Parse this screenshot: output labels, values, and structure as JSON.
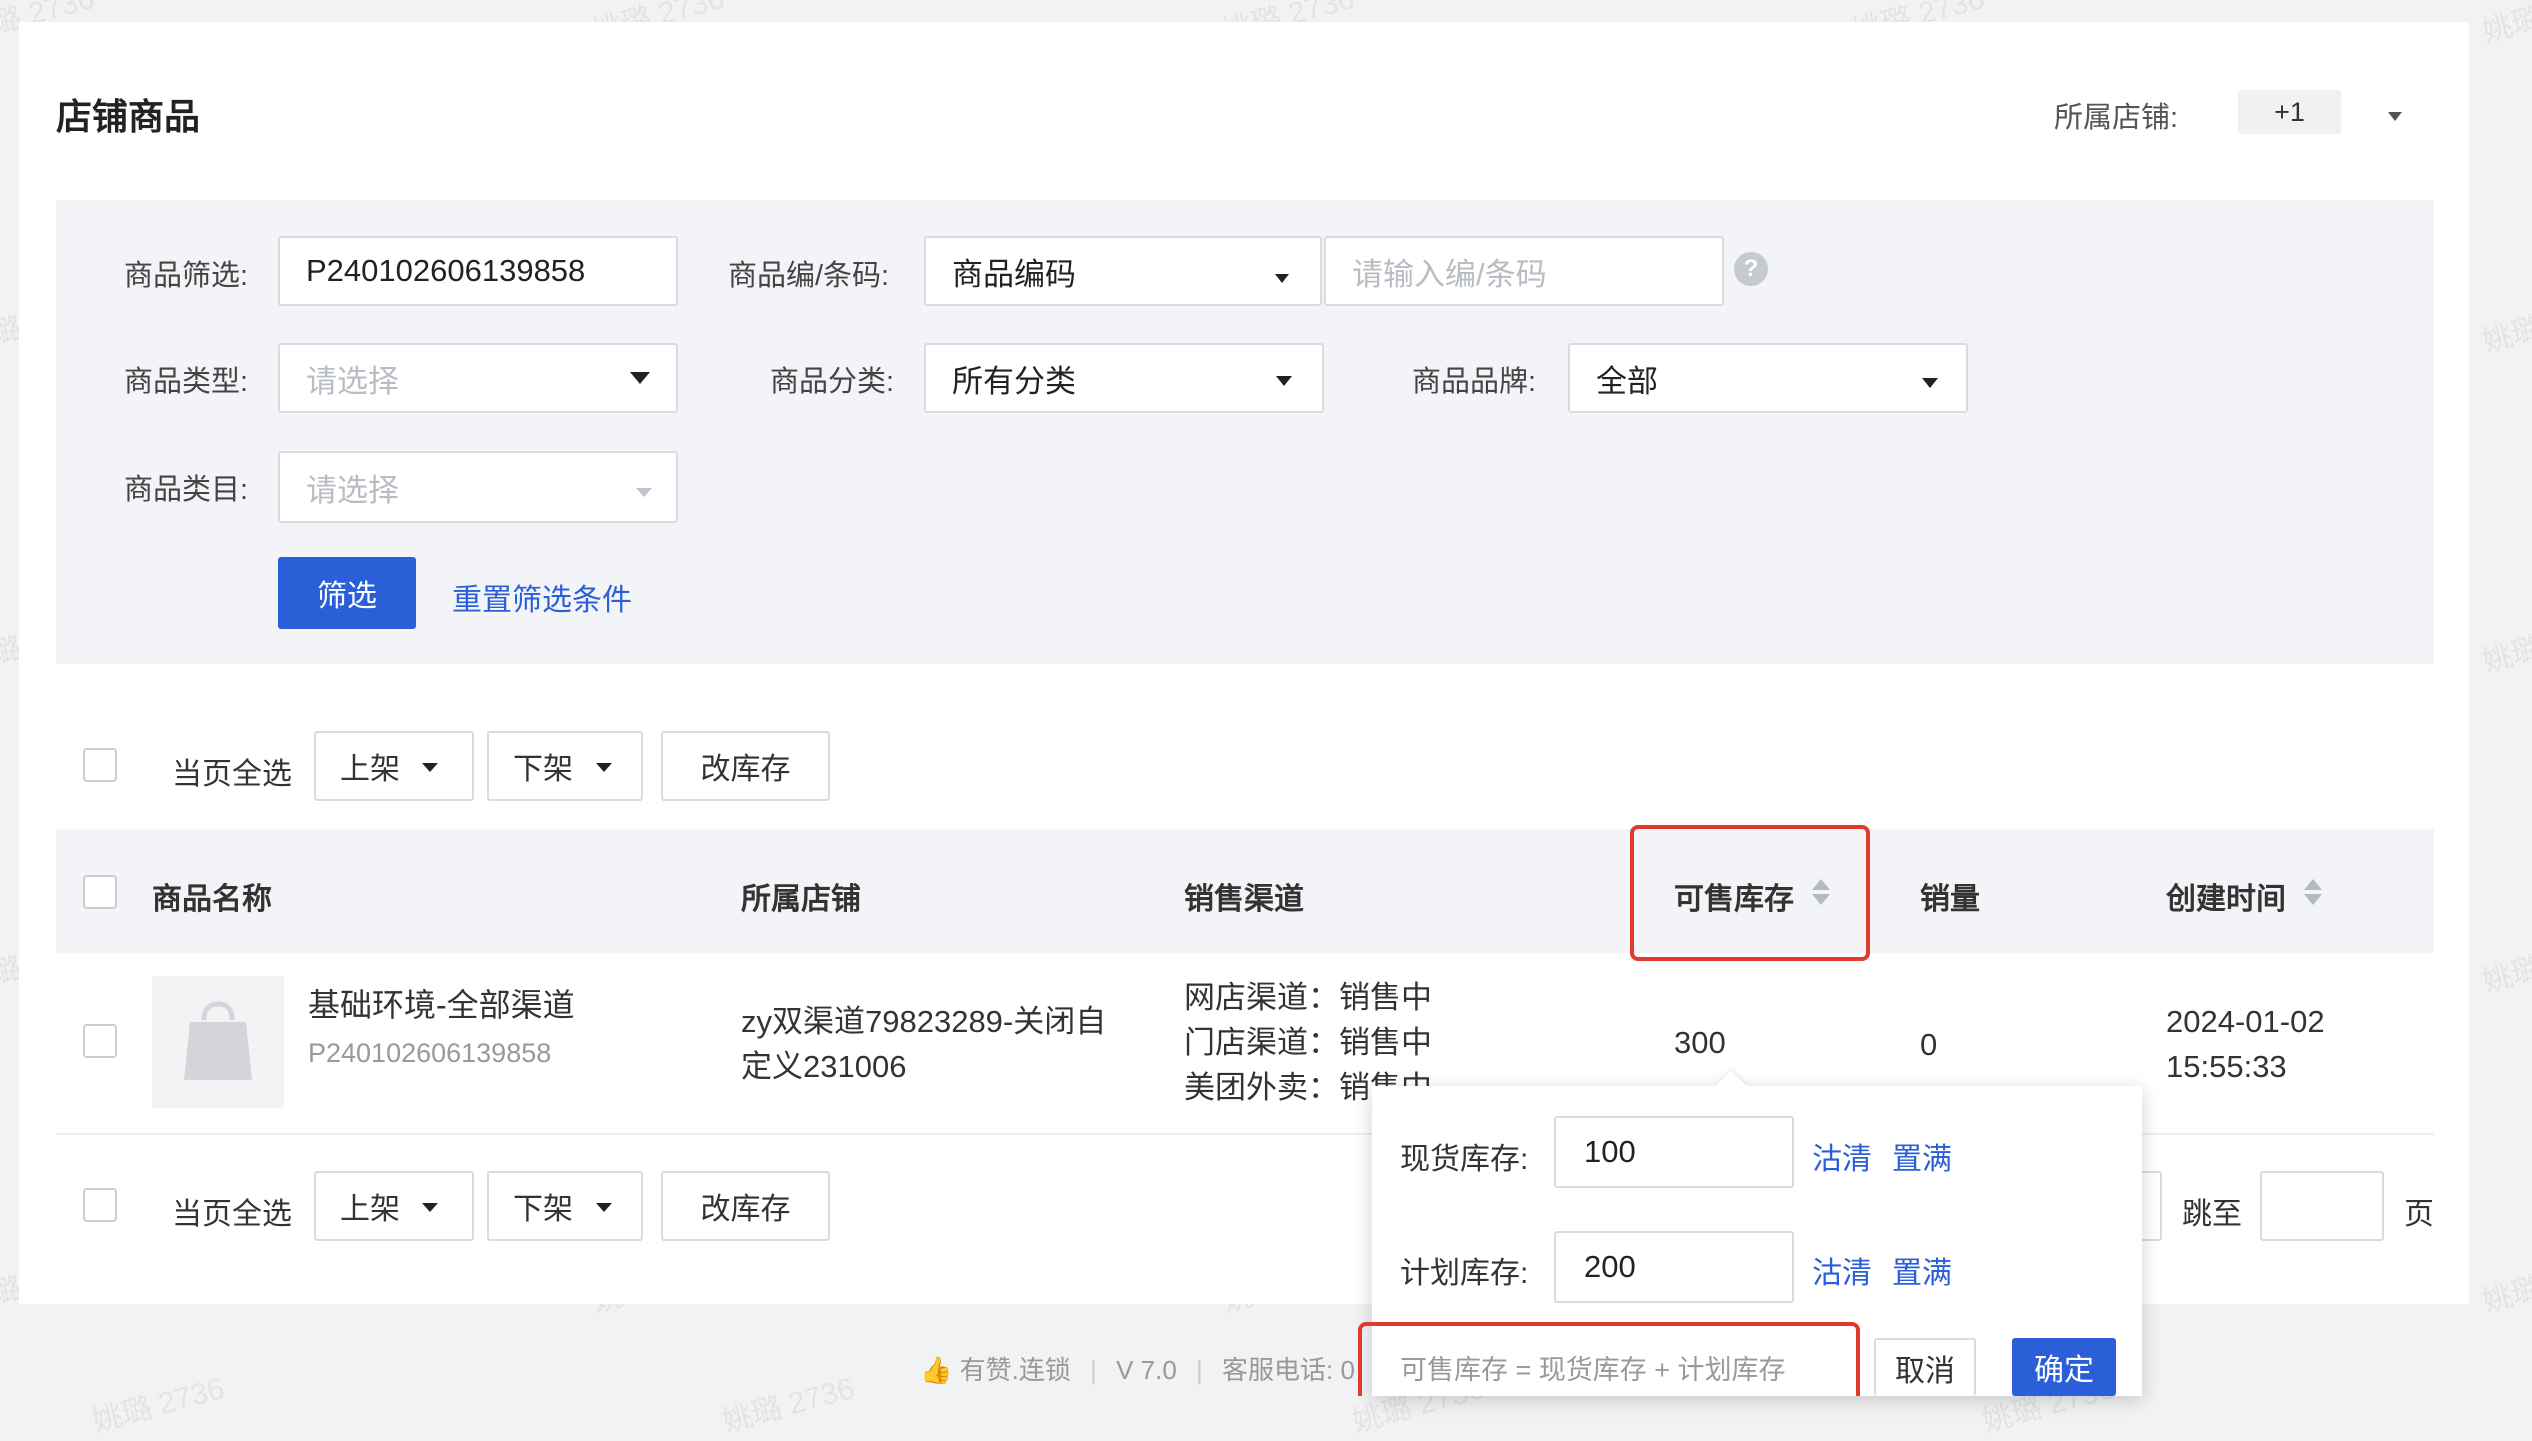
{
  "page": {
    "title": "店铺商品",
    "shop_label": "所属店铺:",
    "shop_tag": "+1"
  },
  "filters": {
    "product_filter": {
      "label": "商品筛选:",
      "value": "P240102606139858"
    },
    "code": {
      "label": "商品编/条码:",
      "select_value": "商品编码",
      "input_placeholder": "请输入编/条码"
    },
    "type": {
      "label": "商品类型:",
      "placeholder": "请选择"
    },
    "category": {
      "label": "商品分类:",
      "value": "所有分类"
    },
    "brand": {
      "label": "商品品牌:",
      "value": "全部"
    },
    "catalog": {
      "label": "商品类目:",
      "placeholder": "请选择"
    },
    "filter_button": "筛选",
    "reset_link": "重置筛选条件",
    "help_glyph": "?"
  },
  "toolbar": {
    "select_all": "当页全选",
    "on_shelf": "上架",
    "off_shelf": "下架",
    "edit_stock": "改库存"
  },
  "table": {
    "headers": {
      "name": "商品名称",
      "shop": "所属店铺",
      "channel": "销售渠道",
      "stock": "可售库存",
      "sales": "销量",
      "created": "创建时间"
    },
    "rows": [
      {
        "name": "基础环境-全部渠道",
        "code": "P240102606139858",
        "shop_line1": "zy双渠道79823289-关闭自",
        "shop_line2": "定义231006",
        "channels": [
          "网店渠道：销售中",
          "门店渠道：销售中",
          "美团外卖：销售中"
        ],
        "stock": "300",
        "sales": "0",
        "created_date": "2024-01-02",
        "created_time": "15:55:33"
      }
    ]
  },
  "pagination": {
    "jump_label": "跳至",
    "page_suffix": "页"
  },
  "stock_popover": {
    "spot_label": "现货库存:",
    "spot_value": "100",
    "plan_label": "计划库存:",
    "plan_value": "200",
    "clear": "沽清",
    "fill": "置满",
    "formula": "可售库存 = 现货库存 + 计划库存",
    "cancel": "取消",
    "confirm": "确定"
  },
  "footer": {
    "brand": "有赞.连锁",
    "sep": "|",
    "version": "V 7.0",
    "service": "客服电话: 0"
  },
  "watermark_text": "姚璐 2736",
  "colors": {
    "primary": "#2a5fd8",
    "highlight": "#e03a2e"
  }
}
